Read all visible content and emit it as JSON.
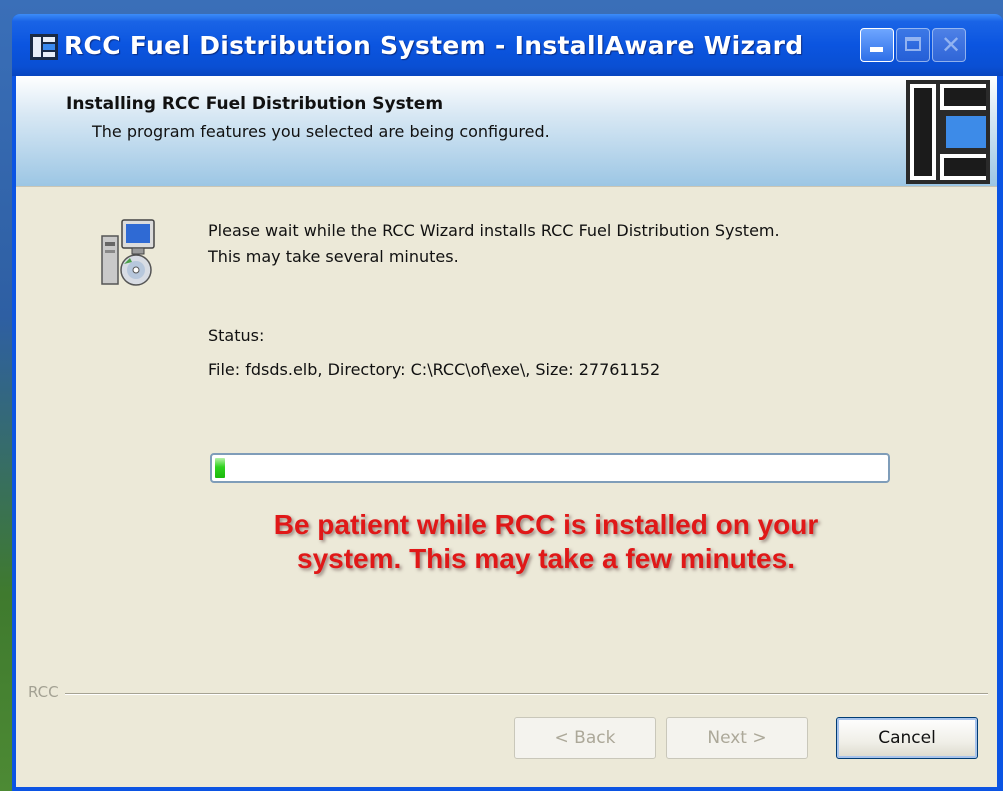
{
  "window": {
    "title": "RCC Fuel Distribution System - InstallAware Wizard",
    "icons": {
      "app": "rcc-app-icon",
      "minimize": "minimize-icon",
      "maximize": "maximize-icon",
      "close": "close-icon"
    },
    "close_glyph": "✕"
  },
  "header": {
    "title": "Installing RCC Fuel Distribution System",
    "subtitle": "The program features you selected are being configured.",
    "logo": "rcc-logo"
  },
  "body": {
    "icon": "setup-install-icon",
    "line1": "Please wait while the RCC Wizard installs RCC Fuel Distribution System.",
    "line2": "This may take several minutes.",
    "status_label": "Status:",
    "status_value": "File: fdsds.elb,  Directory: C:\\RCC\\of\\exe\\,  Size: 27761152",
    "progress_fraction": 0.015,
    "progress_color": "#22c814",
    "notice_line1": "Be patient while RCC is installed on your",
    "notice_line2": "system.  This may take a few minutes.",
    "notice_color": "#e01818"
  },
  "footer": {
    "brand": "RCC",
    "back_label": "< Back",
    "next_label": "Next >",
    "cancel_label": "Cancel"
  },
  "colors": {
    "titlebar": "#0b55e0",
    "client_bg": "#ece9d8"
  }
}
